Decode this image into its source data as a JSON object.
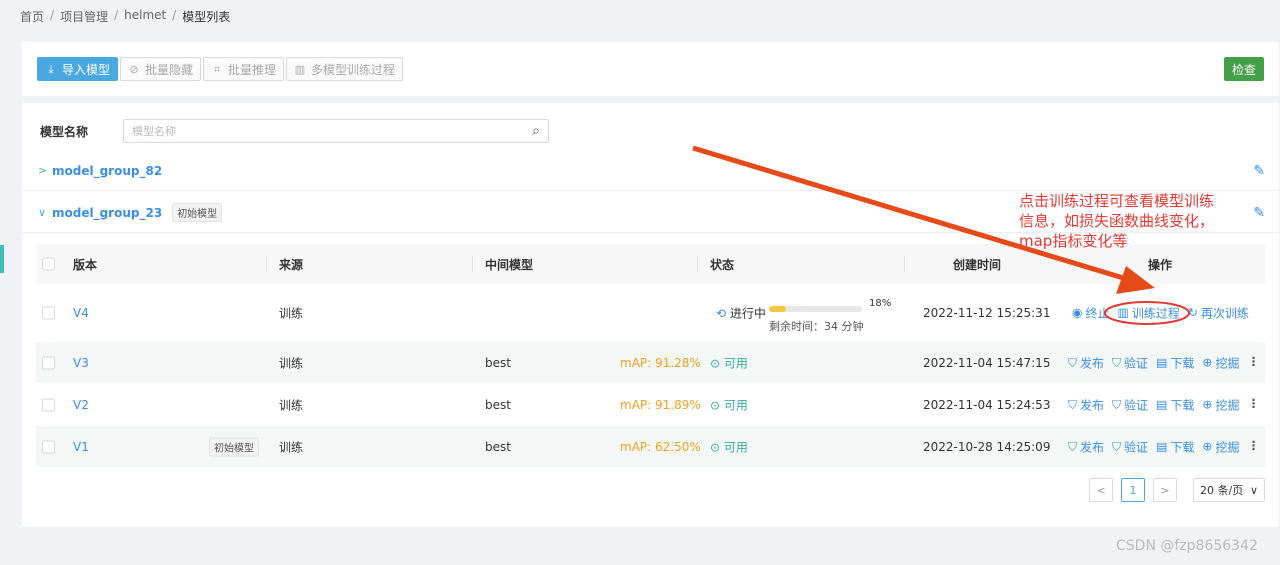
{
  "breadcrumb": {
    "home": "首页",
    "project": "项目管理",
    "helmet": "helmet",
    "current": "模型列表",
    "sep": "/"
  },
  "toolbar": {
    "import_label": "导入模型",
    "batch_hide_label": "批量隐藏",
    "batch_infer_label": "批量推理",
    "multi_train_label": "多模型训练过程",
    "check_label": "检查"
  },
  "filter": {
    "label": "模型名称",
    "placeholder": "模型名称"
  },
  "groups": [
    {
      "name": "model_group_82",
      "tag": ""
    },
    {
      "name": "model_group_23",
      "tag": "初始模型"
    }
  ],
  "table": {
    "headers": {
      "version": "版本",
      "source": "来源",
      "intermediate": "中间模型",
      "status": "状态",
      "created": "创建时间",
      "actions": "操作"
    },
    "rows": [
      {
        "version": "V4",
        "tag": "",
        "source": "训练",
        "intermediate": "",
        "map": "",
        "status": "进行中",
        "progress_label": "18%",
        "progress": 0.18,
        "remaining": "剩余时间：34 分钟",
        "created": "2022-11-12 15:25:31",
        "actions": [
          "终止",
          "训练过程",
          "再次训练"
        ]
      },
      {
        "version": "V3",
        "tag": "",
        "source": "训练",
        "intermediate": "best",
        "map": "mAP: 91.28%",
        "status": "可用",
        "created": "2022-11-04 15:47:15",
        "actions": [
          "发布",
          "验证",
          "下载",
          "挖掘"
        ]
      },
      {
        "version": "V2",
        "tag": "",
        "source": "训练",
        "intermediate": "best",
        "map": "mAP: 91.89%",
        "status": "可用",
        "created": "2022-11-04 15:24:53",
        "actions": [
          "发布",
          "验证",
          "下载",
          "挖掘"
        ]
      },
      {
        "version": "V1",
        "tag": "初始模型",
        "source": "训练",
        "intermediate": "best",
        "map": "mAP: 62.50%",
        "status": "可用",
        "created": "2022-10-28 14:25:09",
        "actions": [
          "发布",
          "验证",
          "下载",
          "挖掘"
        ]
      }
    ]
  },
  "pagination": {
    "current": "1",
    "page_size": "20 条/页"
  },
  "annotation": {
    "line1": "点击训练过程可查看模型训练",
    "line2": "信息，如损失函数曲线变化，",
    "line3": "map指标变化等"
  },
  "watermark": "CSDN @fzp8656342",
  "colors": {
    "accent": "#4aa8e0",
    "success": "#43a047",
    "annotation": "#e53935",
    "map": "#f0a020",
    "status_ok": "#3aaa9e"
  }
}
